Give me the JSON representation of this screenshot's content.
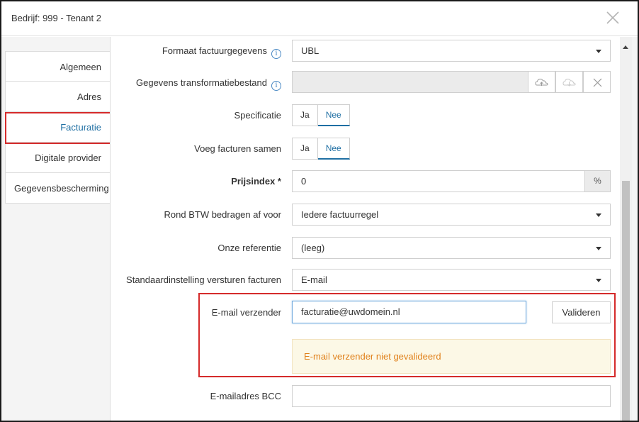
{
  "header": {
    "title": "Bedrijf: 999 - Tenant 2",
    "close_icon": "close-icon"
  },
  "sidebar": {
    "items": [
      {
        "label": "Algemeen"
      },
      {
        "label": "Adres"
      },
      {
        "label": "Facturatie"
      },
      {
        "label": "Digitale provider"
      },
      {
        "label": "Gegevensbescherming"
      }
    ],
    "active": "Facturatie"
  },
  "form": {
    "format": {
      "label": "Formaat factuurgegevens",
      "value": "UBL"
    },
    "transform": {
      "label": "Gegevens transformatiebestand",
      "value": ""
    },
    "specificatie": {
      "label": "Specificatie",
      "yes": "Ja",
      "no": "Nee",
      "selected": "Nee"
    },
    "voeg_samen": {
      "label": "Voeg facturen samen",
      "yes": "Ja",
      "no": "Nee",
      "selected": "Nee"
    },
    "prijsindex": {
      "label": "Prijsindex *",
      "value": "0",
      "suffix": "%"
    },
    "rond_btw": {
      "label": "Rond BTW bedragen af voor",
      "value": "Iedere factuurregel"
    },
    "onze_referentie": {
      "label": "Onze referentie",
      "value": "(leeg)"
    },
    "standaard": {
      "label": "Standaardinstelling versturen facturen",
      "value": "E-mail"
    },
    "email_verzender": {
      "label": "E-mail verzender",
      "value": "facturatie@uwdomein.nl",
      "validate_label": "Valideren",
      "warning": "E-mail verzender niet gevalideerd"
    },
    "bcc": {
      "label": "E-mailadres BCC",
      "value": ""
    }
  },
  "colors": {
    "accent": "#1f6fa3",
    "highlight": "#d52b2b",
    "warning_text": "#e0801a",
    "warning_bg": "#fcf8e6"
  }
}
